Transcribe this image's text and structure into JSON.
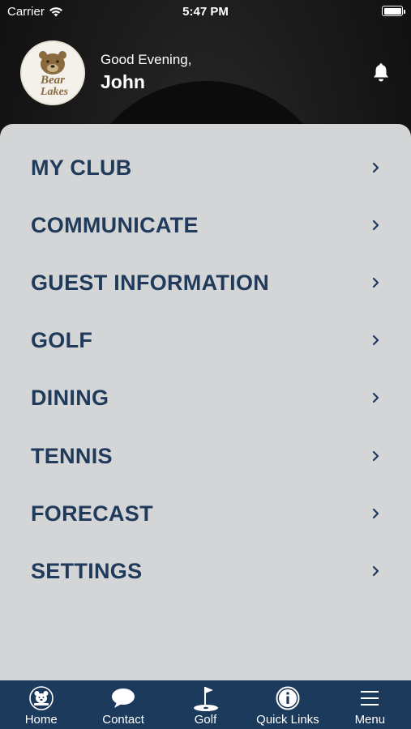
{
  "status_bar": {
    "carrier": "Carrier",
    "time": "5:47 PM"
  },
  "header": {
    "logo_text": [
      "Bear",
      "Lakes"
    ],
    "greeting": "Good Evening,",
    "user_name": "John"
  },
  "menu": {
    "items": [
      {
        "label": "MY CLUB",
        "icon": "chevron-right-icon"
      },
      {
        "label": "COMMUNICATE",
        "icon": "chevron-right-icon"
      },
      {
        "label": "GUEST INFORMATION",
        "icon": "chevron-right-icon"
      },
      {
        "label": "GOLF",
        "icon": "chevron-right-icon"
      },
      {
        "label": "DINING",
        "icon": "chevron-right-icon"
      },
      {
        "label": "TENNIS",
        "icon": "chevron-right-icon"
      },
      {
        "label": "FORECAST",
        "icon": "chevron-right-icon"
      },
      {
        "label": "SETTINGS",
        "icon": "chevron-right-icon"
      }
    ]
  },
  "tabbar": {
    "tabs": [
      {
        "label": "Home",
        "icon": "bear-logo-icon"
      },
      {
        "label": "Contact",
        "icon": "chat-bubble-icon"
      },
      {
        "label": "Golf",
        "icon": "golf-flag-icon"
      },
      {
        "label": "Quick Links",
        "icon": "info-icon"
      },
      {
        "label": "Menu",
        "icon": "hamburger-icon"
      }
    ]
  },
  "colors": {
    "menu_text": "#1f3a5a",
    "tabbar_bg": "#1c3a5c",
    "panel_bg": "#d4d5d6"
  }
}
